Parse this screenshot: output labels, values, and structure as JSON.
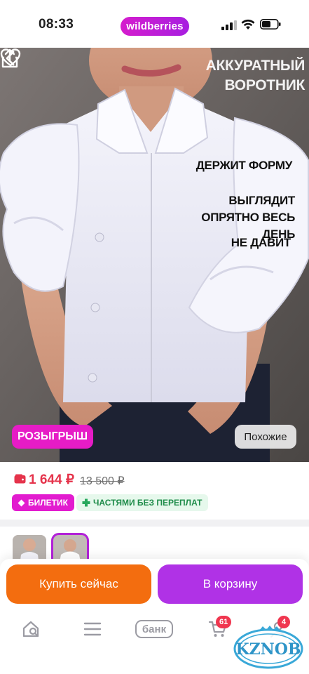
{
  "status": {
    "time": "08:33",
    "brand": "wildberries"
  },
  "hero": {
    "overlay_title": "АККУРАТНЫЙ ВОРОТНИК",
    "bullet_1": "ДЕРЖИТ ФОРМУ",
    "bullet_2": "ВЫГЛЯДИТ ОПРЯТНО ВЕСЬ ДЕНЬ",
    "bullet_3": "НЕ ДАВИТ",
    "giveaway_label": "РОЗЫГРЫШ",
    "similar_label": "Похожие"
  },
  "pricing": {
    "price": "1 644 ₽",
    "old_price": "13 500 ₽",
    "badge_ticket": "БИЛЕТИК",
    "badge_installments": "ЧАСТЯМИ БЕЗ ПЕРЕПЛАТ",
    "price_color": "#e5334b"
  },
  "actions": {
    "buy_now": "Купить сейчас",
    "add_to_cart": "В корзину",
    "buy_color": "#f36d0f",
    "cart_color": "#b032e6"
  },
  "nav": {
    "bank_label": "банк",
    "cart_count": "61",
    "profile_count": "4"
  },
  "watermark": {
    "text": "KZNOB"
  },
  "icons": [
    "back-icon",
    "heart-icon",
    "share-icon",
    "wallet-icon",
    "ticket-icon",
    "cross-icon",
    "home-search-icon",
    "menu-icon",
    "cart-icon",
    "profile-icon"
  ]
}
